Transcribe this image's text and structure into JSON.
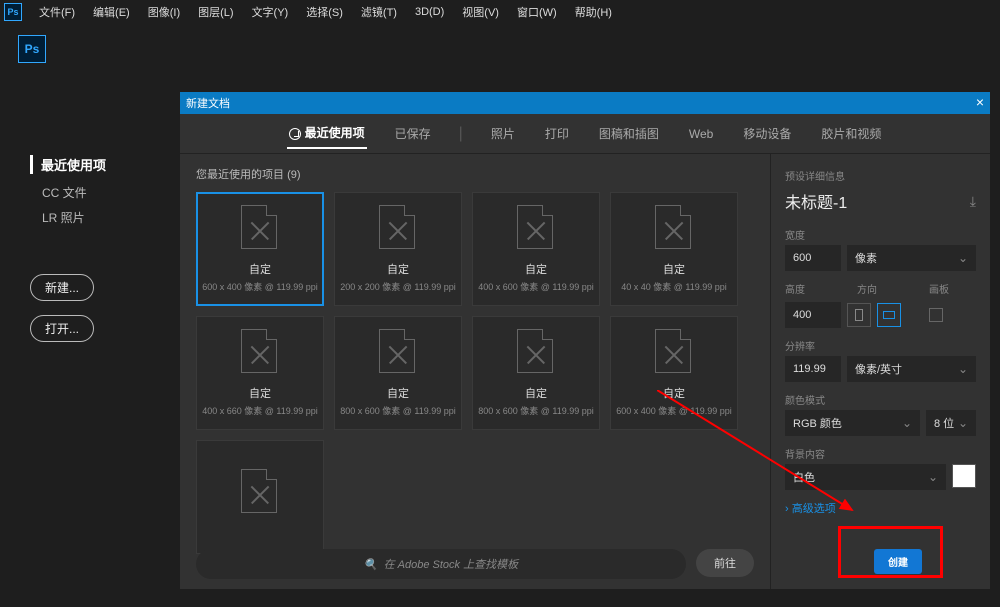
{
  "menubar": {
    "items": [
      "文件(F)",
      "编辑(E)",
      "图像(I)",
      "图层(L)",
      "文字(Y)",
      "选择(S)",
      "滤镜(T)",
      "3D(D)",
      "视图(V)",
      "窗口(W)",
      "帮助(H)"
    ]
  },
  "logo": "Ps",
  "sidebar": {
    "recent": "最近使用项",
    "cc": "CC 文件",
    "lr": "LR 照片",
    "new": "新建...",
    "open": "打开..."
  },
  "dialog": {
    "title": "新建文档",
    "tabs": [
      "最近使用项",
      "已保存",
      "照片",
      "打印",
      "图稿和插图",
      "Web",
      "移动设备",
      "胶片和视频"
    ],
    "recent_head": "您最近使用的项目",
    "recent_count": "(9)",
    "presets": [
      {
        "name": "自定",
        "sub": "600 x 400 像素 @ 119.99 ppi"
      },
      {
        "name": "自定",
        "sub": "200 x 200 像素 @ 119.99 ppi"
      },
      {
        "name": "自定",
        "sub": "400 x 600 像素 @ 119.99 ppi"
      },
      {
        "name": "自定",
        "sub": "40 x 40 像素 @ 119.99 ppi"
      },
      {
        "name": "自定",
        "sub": "400 x 660 像素 @ 119.99 ppi"
      },
      {
        "name": "自定",
        "sub": "800 x 600 像素 @ 119.99 ppi"
      },
      {
        "name": "自定",
        "sub": "800 x 600 像素 @ 119.99 ppi"
      },
      {
        "name": "自定",
        "sub": "600 x 400 像素 @ 119.99 ppi"
      },
      {
        "name": "",
        "sub": ""
      }
    ],
    "search_placeholder": "在 Adobe Stock 上查找模板",
    "go": "前往"
  },
  "rpanel": {
    "heading": "预设详细信息",
    "name": "未标题-1",
    "width_lbl": "宽度",
    "width_val": "600",
    "unit_px": "像素",
    "height_lbl": "高度",
    "orient_lbl": "方向",
    "artboard_lbl": "画板",
    "height_val": "400",
    "res_lbl": "分辨率",
    "res_val": "119.99",
    "res_unit": "像素/英寸",
    "color_lbl": "颜色模式",
    "color_mode": "RGB 颜色",
    "bit_depth": "8 位",
    "bg_lbl": "背景内容",
    "bg_val": "白色",
    "advanced": "高级选项",
    "create": "创建"
  }
}
